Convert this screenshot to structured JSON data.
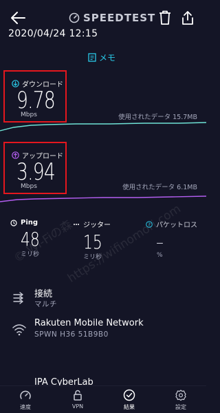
{
  "header": {
    "brand": "SPEEDTEST",
    "datetime": "2020/04/24 12:15"
  },
  "memo": {
    "label": "メモ"
  },
  "download": {
    "label": "ダウンロード",
    "value": "9.78",
    "unit": "Mbps",
    "data_used": "使用されたデータ 15.7MB"
  },
  "upload": {
    "label": "アップロード",
    "value": "3.94",
    "unit": "Mbps",
    "data_used": "使用されたデータ 6.1MB"
  },
  "stats": {
    "ping": {
      "label": "Ping",
      "value": "48",
      "unit": "ミリ秒"
    },
    "jitter": {
      "label": "ジッター",
      "value": "15",
      "unit": "ミリ秒"
    },
    "packet_loss": {
      "label": "パケットロス",
      "value": "–",
      "unit": "%"
    }
  },
  "connection": {
    "title": "接続",
    "subtitle": "マルチ"
  },
  "network": {
    "name": "Rakuten Mobile Network",
    "detail": "SPWN H36 51B9B0"
  },
  "server": {
    "name": "IPA CyberLab"
  },
  "nav": {
    "speed": "速度",
    "vpn": "VPN",
    "results": "結果",
    "settings": "設定"
  },
  "watermark": {
    "text1": "© Wi-Fiの森",
    "text2": "https://wifinomori.com"
  },
  "colors": {
    "background": "#141526",
    "accent_cyan": "#29c9e8",
    "accent_purple": "#b35ef0",
    "highlight_red": "#e5171e"
  }
}
